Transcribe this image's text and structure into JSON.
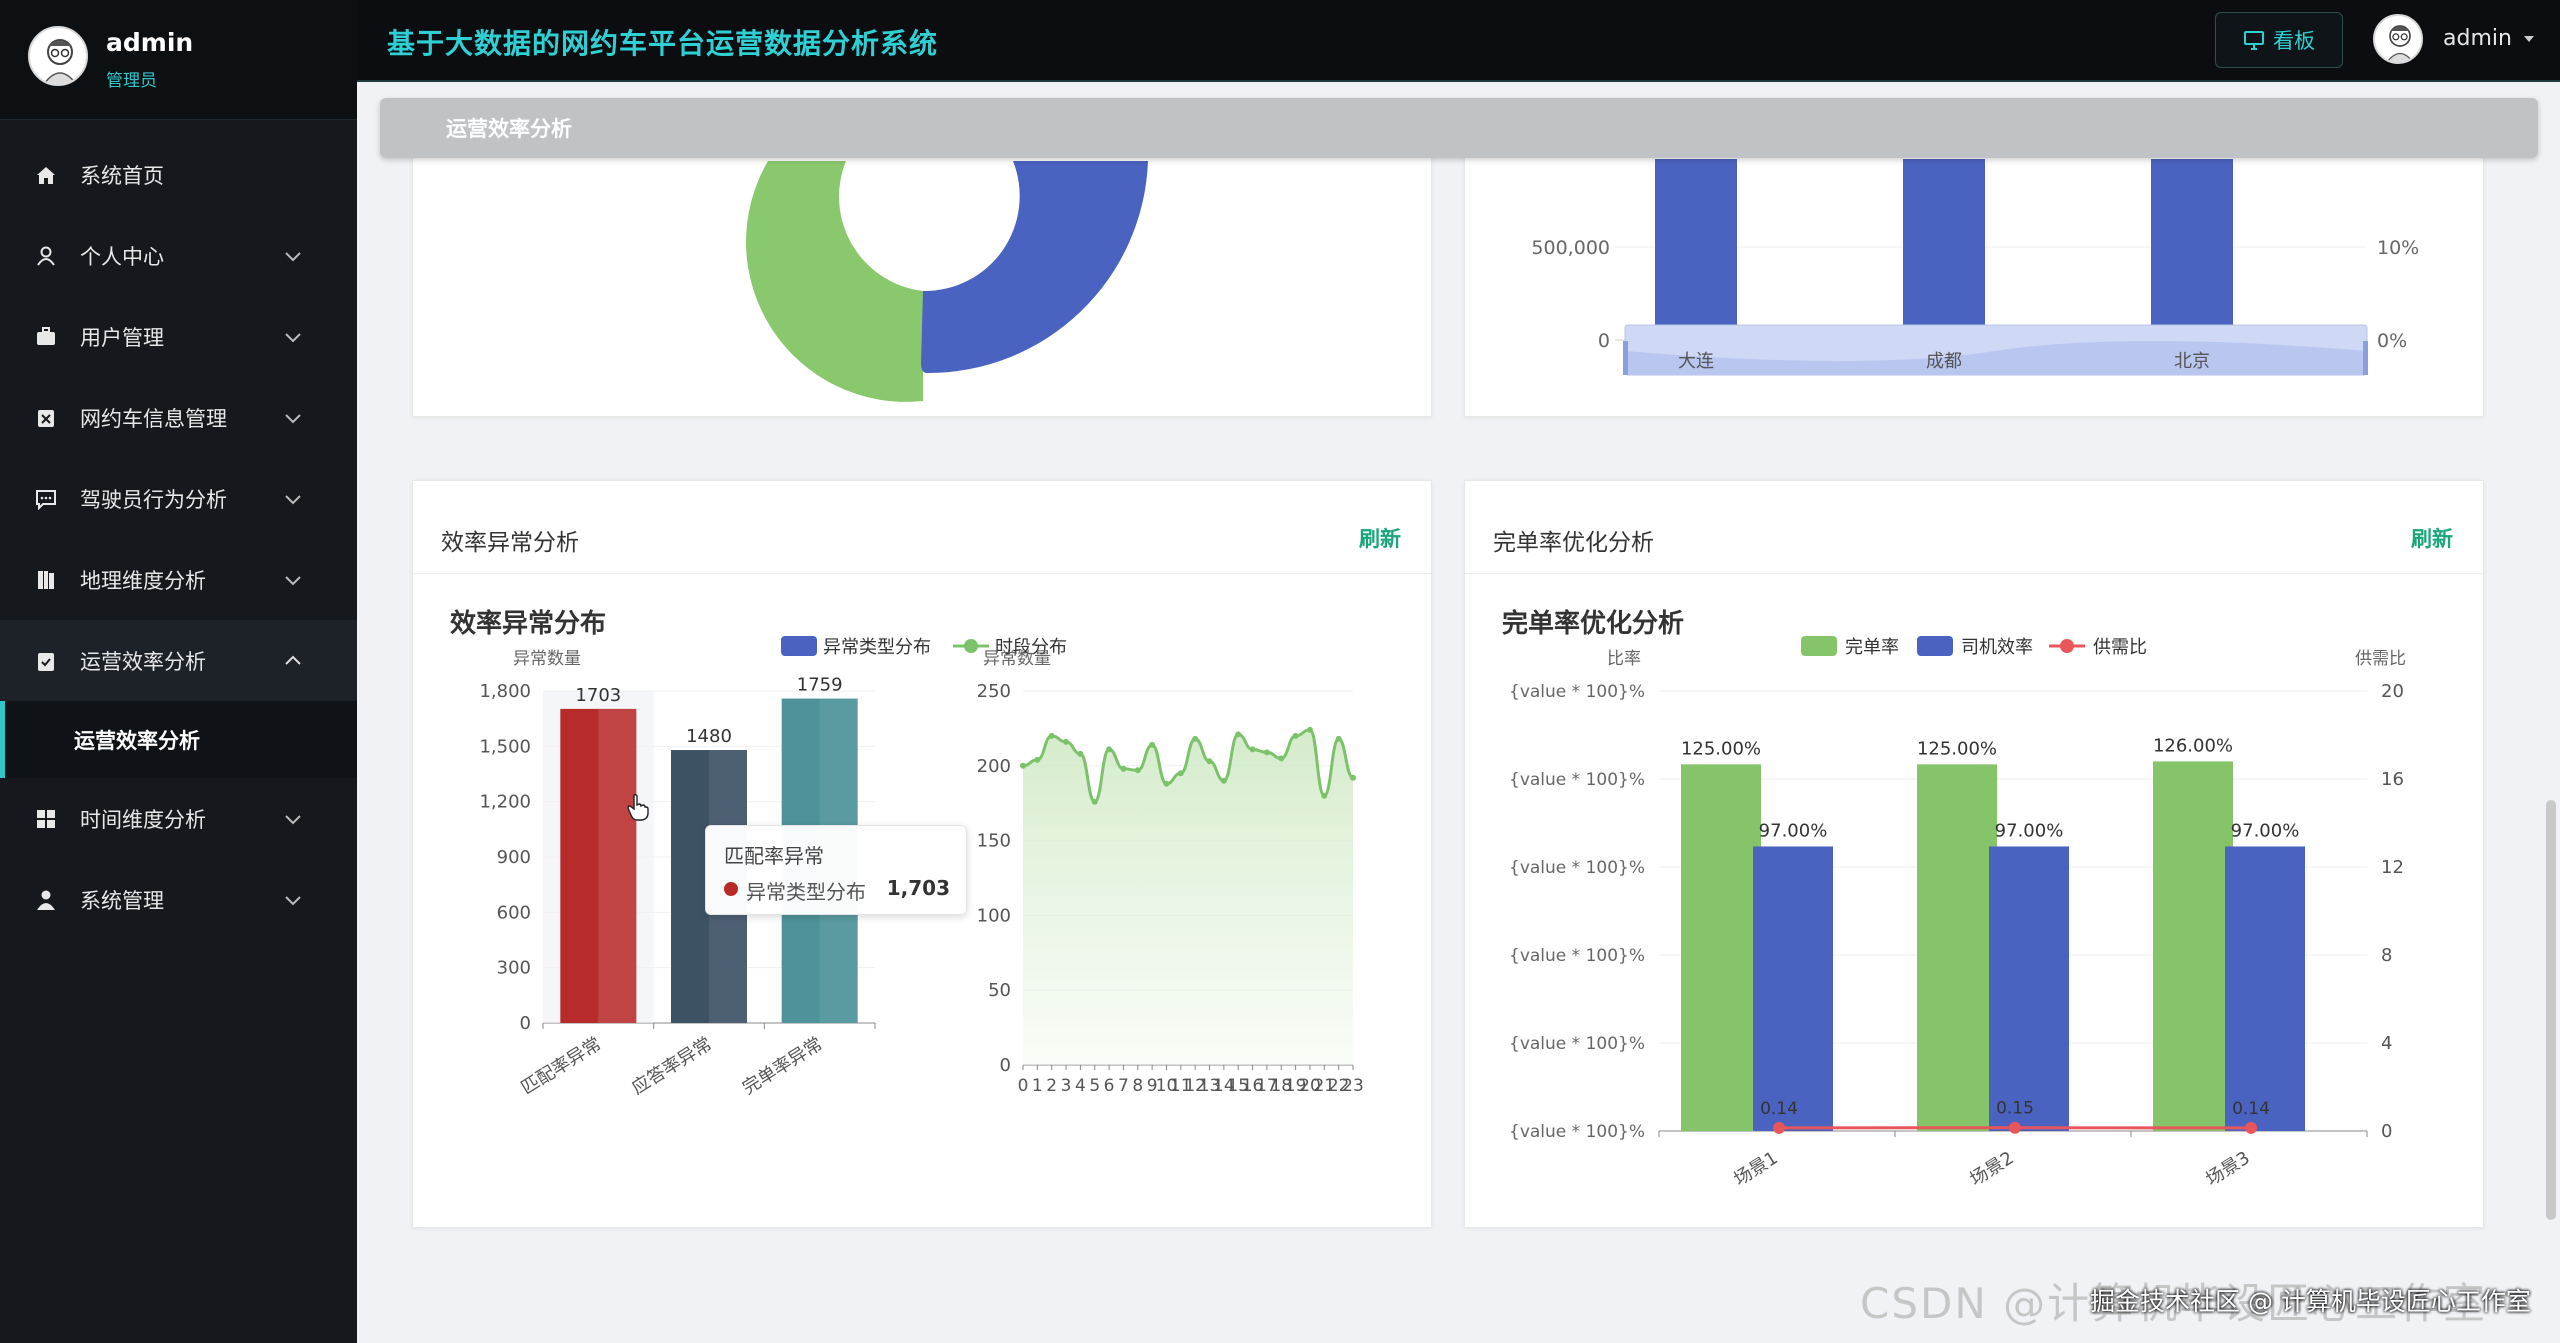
{
  "app": {
    "title": "基于大数据的网约车平台运营数据分析系统",
    "board_label": "看板",
    "user": "admin",
    "role": "管理员"
  },
  "sidebar": {
    "items": [
      {
        "label": "系统首页",
        "icon": "home-icon"
      },
      {
        "label": "个人中心",
        "icon": "user-icon"
      },
      {
        "label": "用户管理",
        "icon": "briefcase-icon"
      },
      {
        "label": "网约车信息管理",
        "icon": "car-icon"
      },
      {
        "label": "驾驶员行为分析",
        "icon": "chat-icon"
      },
      {
        "label": "地理维度分析",
        "icon": "book-icon"
      },
      {
        "label": "运营效率分析",
        "icon": "clipboard-icon"
      },
      {
        "label": "运营效率分析",
        "icon": ""
      },
      {
        "label": "时间维度分析",
        "icon": "grid-icon"
      },
      {
        "label": "系统管理",
        "icon": "person-icon"
      }
    ]
  },
  "breadcrumb": "运营效率分析",
  "top_right_chart": {
    "y_ticks": [
      "500,000",
      "0"
    ],
    "y2_ticks": [
      "10%",
      "0%"
    ],
    "categories": [
      "大连",
      "成都",
      "北京"
    ]
  },
  "panel_left": {
    "title": "效率异常分析",
    "refresh": "刷新",
    "chart_title": "效率异常分布",
    "legend": [
      "异常类型分布",
      "时段分布"
    ],
    "tooltip": {
      "title": "匹配率异常",
      "series": "异常类型分布",
      "value": "1,703"
    }
  },
  "panel_right": {
    "title": "完单率优化分析",
    "refresh": "刷新",
    "chart_title": "完单率优化分析",
    "legend": [
      "完单率",
      "司机效率",
      "供需比"
    ]
  },
  "chart_data": [
    {
      "type": "bar",
      "ylabel": "异常数量",
      "categories": [
        "匹配率异常",
        "应答率异常",
        "完单率异常"
      ],
      "values": [
        1703,
        1480,
        1759
      ],
      "ylim": [
        0,
        1800
      ],
      "yticks": [
        0,
        300,
        600,
        900,
        1200,
        1500,
        1800
      ],
      "colors": [
        "#b82b2b",
        "#3e5266",
        "#4d9399"
      ]
    },
    {
      "type": "line",
      "ylabel": "异常数量",
      "x": [
        0,
        1,
        2,
        3,
        4,
        5,
        6,
        7,
        8,
        9,
        10,
        11,
        12,
        13,
        14,
        15,
        16,
        17,
        18,
        19,
        20,
        21,
        22,
        23
      ],
      "ylim": [
        0,
        250
      ],
      "yticks": [
        0,
        50,
        100,
        150,
        200,
        250
      ],
      "values": [
        200,
        204,
        220,
        216,
        208,
        176,
        211,
        198,
        197,
        214,
        188,
        195,
        218,
        203,
        190,
        221,
        211,
        209,
        205,
        220,
        224,
        180,
        218,
        192
      ],
      "color": "#7cc26b"
    },
    {
      "type": "bar",
      "ylabel": "比率",
      "y2label": "供需比",
      "categories": [
        "场景1",
        "场景2",
        "场景3"
      ],
      "ytick_label": "{value * 100}%",
      "y2ticks": [
        0,
        4,
        8,
        12,
        16,
        20
      ],
      "series": [
        {
          "name": "完单率",
          "values": [
            1.25,
            1.25,
            1.26
          ],
          "labels": [
            "125.00%",
            "125.00%",
            "126.00%"
          ],
          "color": "#86c46a"
        },
        {
          "name": "司机效率",
          "values": [
            0.97,
            0.97,
            0.97
          ],
          "labels": [
            "97.00%",
            "97.00%",
            "97.00%"
          ],
          "color": "#4a62c0"
        },
        {
          "name": "供需比",
          "values": [
            0.14,
            0.15,
            0.14
          ],
          "labels": [
            "0.14",
            "0.15",
            "0.14"
          ],
          "color": "#e8555a"
        }
      ]
    }
  ],
  "watermark": "CSDN @计算机毕设匠心工作室",
  "watermark2": "掘金技术社区 @ 计算机毕设匠心工作室"
}
